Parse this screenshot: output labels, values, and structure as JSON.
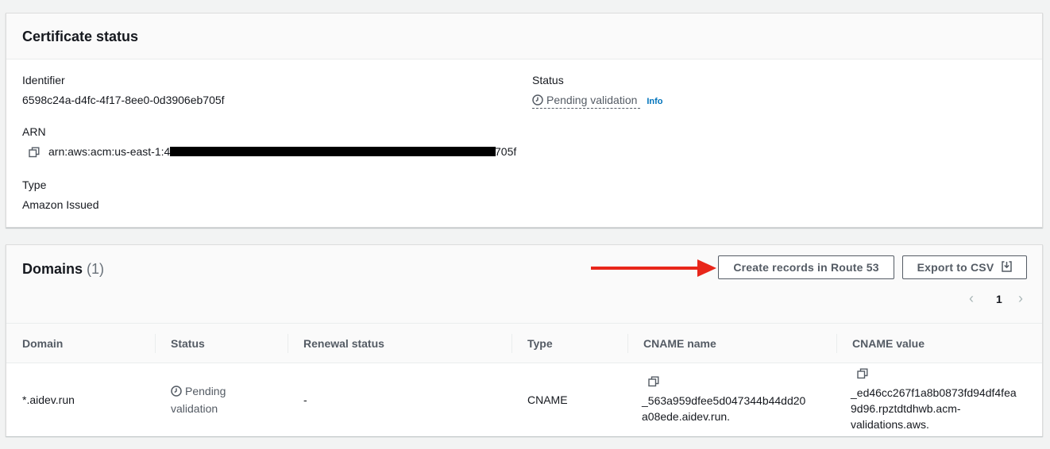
{
  "certificate_status": {
    "title": "Certificate status",
    "identifier_label": "Identifier",
    "identifier_value": "6598c24a-d4fc-4f17-8ee0-0d3906eb705f",
    "status_label": "Status",
    "status_value": "Pending validation",
    "info_link": "Info",
    "arn_label": "ARN",
    "arn_prefix": "arn:aws:acm:us-east-1:4",
    "arn_suffix": "705f",
    "type_label": "Type",
    "type_value": "Amazon Issued"
  },
  "domains": {
    "title": "Domains",
    "count": "(1)",
    "create_records_button": "Create records in Route 53",
    "export_button": "Export to CSV",
    "page_number": "1",
    "columns": [
      "Domain",
      "Status",
      "Renewal status",
      "Type",
      "CNAME name",
      "CNAME value"
    ],
    "rows": [
      {
        "domain": "*.aidev.run",
        "status_line1": "Pending",
        "status_line2": "validation",
        "renewal_status": "-",
        "type": "CNAME",
        "cname_name_line1": "_563a959dfee5d047344b44dd20",
        "cname_name_line2": "a08ede.aidev.run.",
        "cname_value_line1": "_ed46cc267f1a8b0873fd94df4fea",
        "cname_value_line2": "9d96.rpztdtdhwb.acm-",
        "cname_value_line3": "validations.aws."
      }
    ]
  },
  "annotation": {
    "arrow_color": "#e8261a"
  },
  "icons": [
    "copy-icon",
    "clock-icon",
    "download-icon",
    "chevron-left-icon",
    "chevron-right-icon",
    "arrow-annotation"
  ]
}
